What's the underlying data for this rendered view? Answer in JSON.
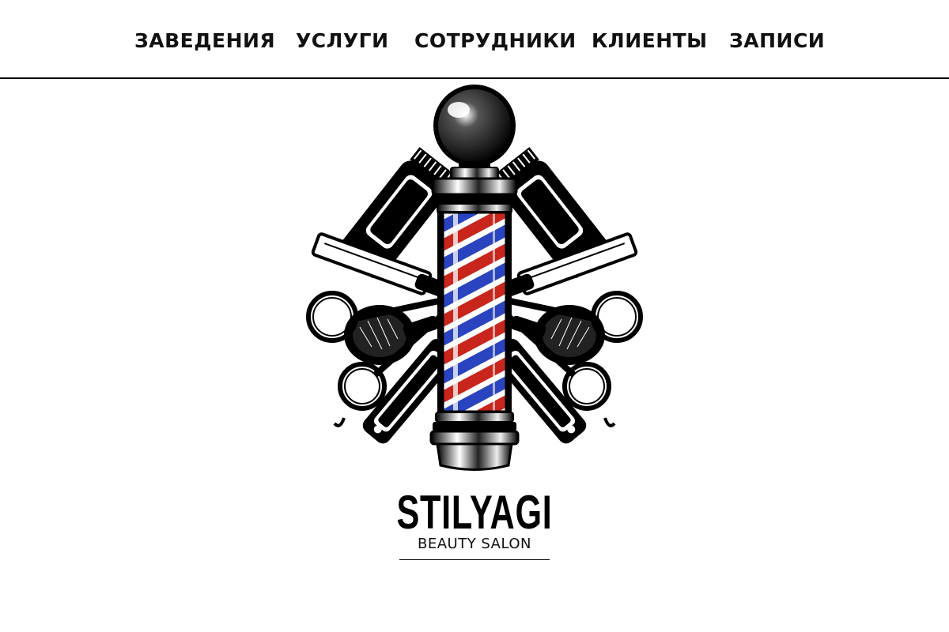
{
  "nav": {
    "items": [
      {
        "label": "ЗАВЕДЕНИЯ"
      },
      {
        "label": "УСЛУГИ"
      },
      {
        "label": "СОТРУДНИКИ"
      },
      {
        "label": "КЛИЕНТЫ"
      },
      {
        "label": "ЗАПИСИ"
      }
    ]
  },
  "logo": {
    "title": "STILYAGI",
    "subtitle": "BEAUTY SALON",
    "icon": "barber-pole-emblem-icon",
    "colors": {
      "stripe_red": "#c8261c",
      "stripe_blue": "#2a44c0",
      "ink": "#000000"
    }
  }
}
